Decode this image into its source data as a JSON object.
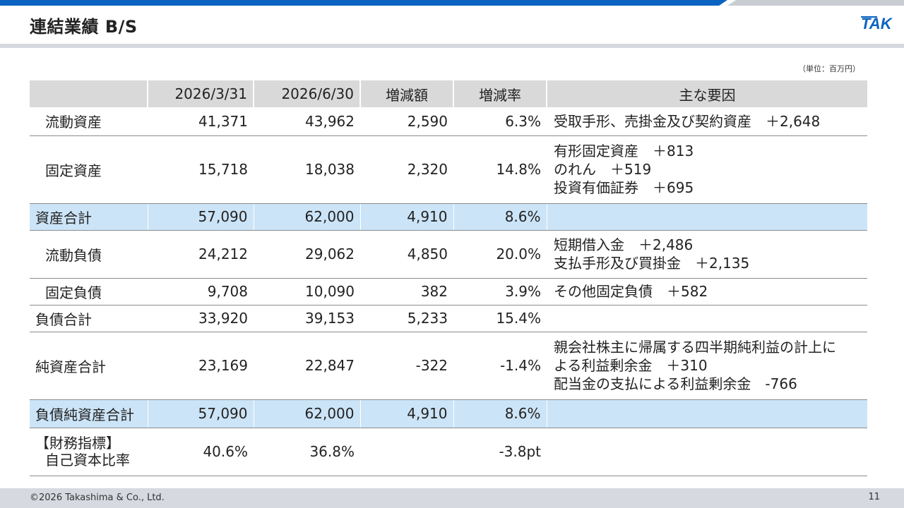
{
  "header": {
    "title": "連結業績 B/S",
    "logo_text": "TAK",
    "unit": "（単位：百万円）"
  },
  "colors": {
    "accent": "#0b63c1",
    "highlight_row": "#cce4f7",
    "header_bg": "#d9d9d9"
  },
  "table": {
    "columns": [
      "",
      "2026/3/31",
      "2026/6/30",
      "増減額",
      "増減率",
      "主な要因"
    ],
    "rows": [
      {
        "label": "流動資産",
        "v1": "41,371",
        "v2": "43,962",
        "diff": "2,590",
        "rate": "6.3%",
        "factors": [
          "受取手形、売掛金及び契約資産　＋2,648"
        ]
      },
      {
        "label": "固定資産",
        "v1": "15,718",
        "v2": "18,038",
        "diff": "2,320",
        "rate": "14.8%",
        "factors": [
          "有形固定資産　＋813",
          "のれん　＋519",
          "投資有価証券　＋695"
        ]
      },
      {
        "label": "資産合計",
        "v1": "57,090",
        "v2": "62,000",
        "diff": "4,910",
        "rate": "8.6%",
        "factors": []
      },
      {
        "label": "流動負債",
        "v1": "24,212",
        "v2": "29,062",
        "diff": "4,850",
        "rate": "20.0%",
        "factors": [
          "短期借入金　＋2,486",
          "支払手形及び買掛金　＋2,135"
        ]
      },
      {
        "label": "固定負債",
        "v1": "9,708",
        "v2": "10,090",
        "diff": "382",
        "rate": "3.9%",
        "factors": [
          "その他固定負債　＋582"
        ]
      },
      {
        "label": "負債合計",
        "v1": "33,920",
        "v2": "39,153",
        "diff": "5,233",
        "rate": "15.4%",
        "factors": []
      },
      {
        "label": "純資産合計",
        "v1": "23,169",
        "v2": "22,847",
        "diff": "-322",
        "rate": "-1.4%",
        "factors": [
          "親会社株主に帰属する四半期純利益の計上に",
          "よる利益剰余金　＋310",
          "配当金の支払による利益剰余金　-766"
        ]
      },
      {
        "label": "負債純資産合計",
        "v1": "57,090",
        "v2": "62,000",
        "diff": "4,910",
        "rate": "8.6%",
        "factors": []
      },
      {
        "label_lines": [
          "【財務指標】",
          "自己資本比率"
        ],
        "v1": "40.6%",
        "v2": "36.8%",
        "diff": "",
        "rate": "-3.8pt",
        "factors": []
      }
    ]
  },
  "footer": {
    "copyright": "©2026 Takashima & Co., Ltd.",
    "page": "11"
  }
}
